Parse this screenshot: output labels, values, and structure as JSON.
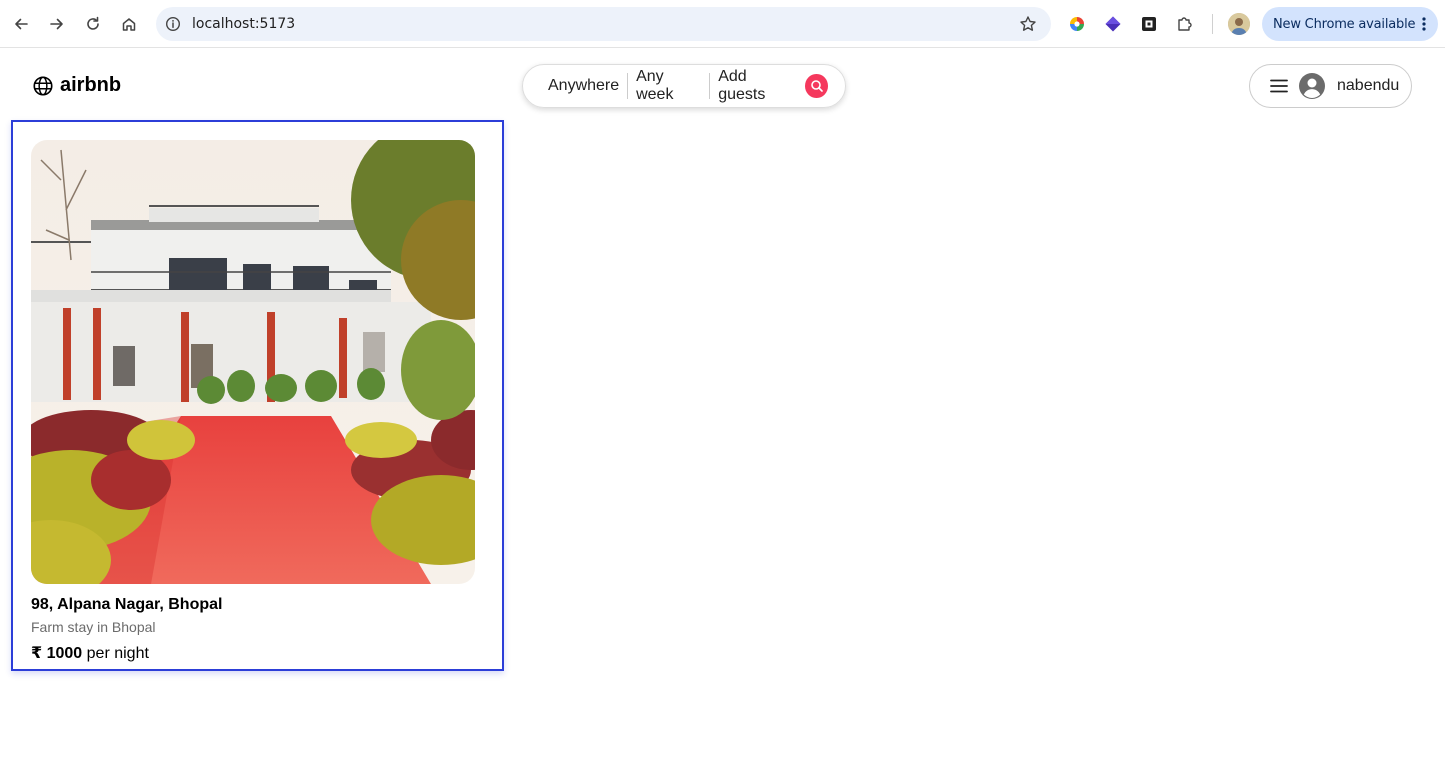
{
  "browser": {
    "url": "localhost:5173",
    "update_label": "New Chrome available"
  },
  "header": {
    "logo_text": "airbnb",
    "search": {
      "where": "Anywhere",
      "when": "Any week",
      "who": "Add guests"
    },
    "user": {
      "name": "nabendu"
    }
  },
  "listing": {
    "title": "98, Alpana Nagar, Bhopal",
    "subtitle": "Farm stay in Bhopal",
    "currency": "₹",
    "price": "1000",
    "price_suffix": "per night"
  },
  "colors": {
    "accent": "#f5385d",
    "card_outline": "#2c3ed8",
    "chrome_update_pill": "#d3e3fd",
    "omnibox": "#edf2fa"
  },
  "icons": {
    "back": "arrow-left-icon",
    "forward": "arrow-right-icon",
    "reload": "reload-icon",
    "home": "home-icon",
    "site_info": "info-icon",
    "bookmark": "star-icon",
    "search_go": "search-icon",
    "menu": "hamburger-icon",
    "user": "user-circle-icon",
    "logo": "globe-icon"
  }
}
